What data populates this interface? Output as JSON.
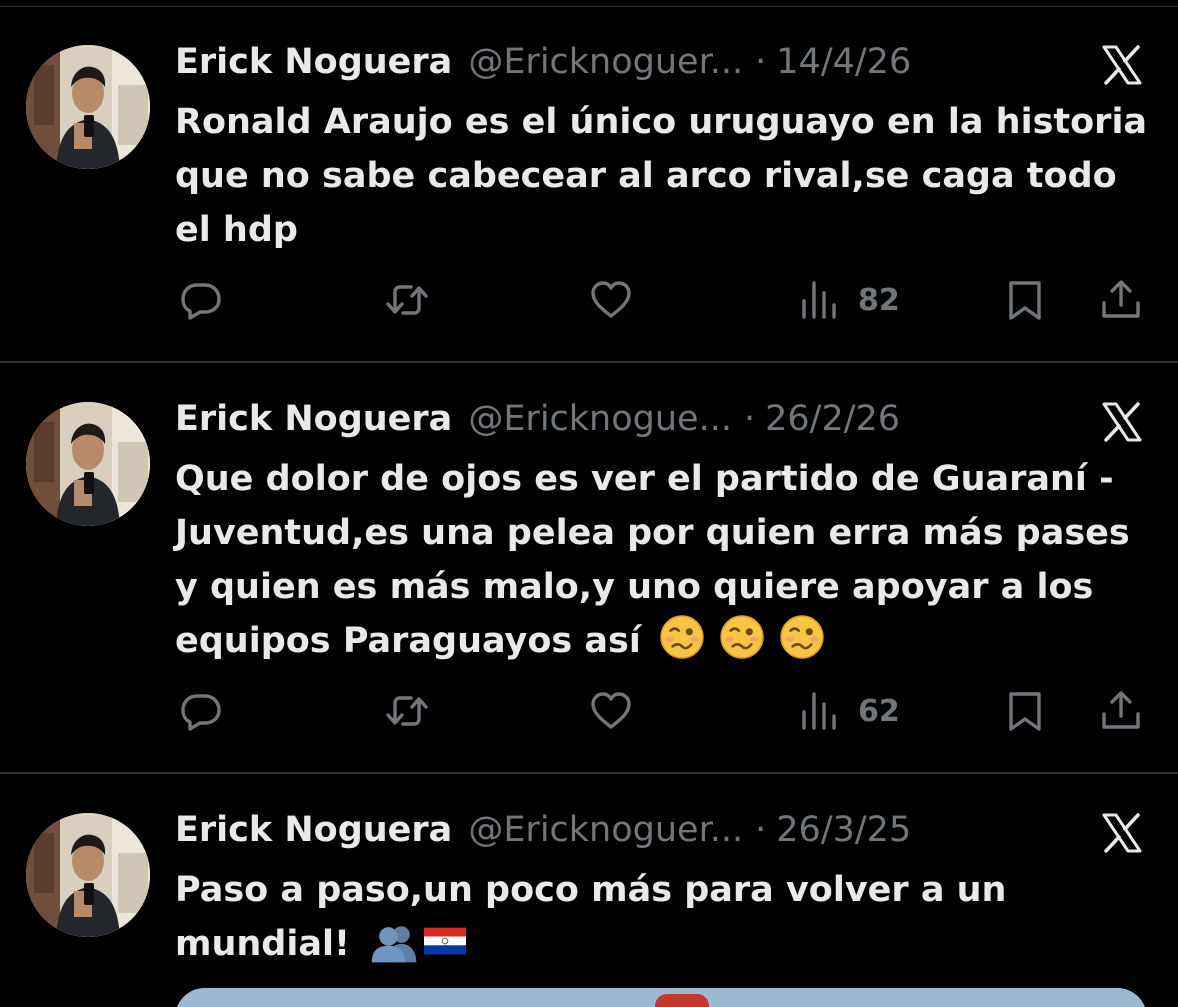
{
  "tweets": [
    {
      "name": "Erick Noguera",
      "handle": "@Ericknoguer...",
      "dot": "·",
      "date": "14/4/26",
      "text": "Ronald Araujo es el único uruguayo en la historia que no sabe cabecear al arco rival,se caga todo el hdp",
      "views": "82"
    },
    {
      "name": "Erick Noguera",
      "handle": "@Ericknogue...",
      "dot": "·",
      "date": "26/2/26",
      "text": "Que dolor de ojos es ver el partido de Guaraní - Juventud,es una pelea por quien erra más pases y quien es más malo,y uno quiere apoyar a los equipos Paraguayos así",
      "emojis": [
        "woozy-face",
        "woozy-face",
        "woozy-face"
      ],
      "views": "62"
    },
    {
      "name": "Erick Noguera",
      "handle": "@Ericknoguer...",
      "dot": "·",
      "date": "26/3/25",
      "text": "Paso a paso,un poco más para volver a un mundial!",
      "emojis": [
        "busts-in-silhouette",
        "flag-paraguay"
      ]
    }
  ],
  "icons": [
    "x-logo-icon",
    "reply-icon",
    "retweet-icon",
    "like-icon",
    "views-icon",
    "bookmark-icon",
    "share-icon"
  ],
  "colors": {
    "background": "#000000",
    "text": "#e7e9ea",
    "secondary": "#71767b",
    "divider": "#2f3336"
  }
}
